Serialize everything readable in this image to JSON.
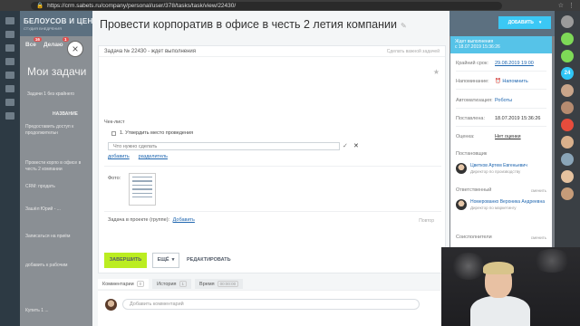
{
  "browser": {
    "url": "https://crm.sabets.ru/company/personal/user/378/tasks/task/view/22430/"
  },
  "background": {
    "company": "БЕЛОУСОВ И ЦЕНТР",
    "company_sub": "СТУДИЯ ВНЕДРЕНИЯ",
    "tabs": [
      {
        "label": "Все",
        "count": "16"
      },
      {
        "label": "Делаю",
        "count": "1"
      }
    ],
    "page_title": "Мои задачи",
    "meta": "Задачи  1  без крайнего",
    "column": "НАЗВАНИЕ",
    "rows": [
      "Предоставить доступ к продолжительн",
      "Провести корпо в офисе в честь 2 компании",
      "CRM: продать",
      "Зашёл Юрий - ...",
      "Записаться на приём",
      "добавить к рабочим",
      "Купить 1 ..."
    ]
  },
  "panel": {
    "title": "Провести корпоратив в офисе в честь 2 летия компании",
    "task_id": "Задача № 22430 - ждет выполнения",
    "important": "Сделать важной задачей",
    "add_button": "ДОБАВИТЬ"
  },
  "checklist": {
    "title": "Чек-лист",
    "item": "1. Утвердить место проведения",
    "input_placeholder": "Что нужно сделать",
    "add_link": "добавить",
    "separator_link": "разделитель"
  },
  "photo": {
    "label": "Фото:"
  },
  "project": {
    "label": "Задача в проекте (группе):",
    "link": "Добавить",
    "repeat": "Повтор"
  },
  "actions": {
    "done": "ЗАВЕРШИТЬ",
    "more": "ЕЩЁ",
    "edit": "РЕДАКТИРОВАТЬ"
  },
  "tabs": [
    {
      "label": "Комментарии",
      "count": "0"
    },
    {
      "label": "История",
      "count": "1"
    },
    {
      "label": "Время",
      "count": "00:00:00"
    }
  ],
  "comment": {
    "placeholder": "Добавить комментарий"
  },
  "sidebar": {
    "status": "Ждет выполнения",
    "status_date": "с 18.07.2019 15:36:26",
    "deadline_label": "Крайний срок:",
    "deadline_value": "29.08.2019 19:00",
    "reminder_label": "Напоминание:",
    "reminder_value": "Напомнить",
    "automation_label": "Автоматизация:",
    "automation_value": "Роботы",
    "created_label": "Поставлена:",
    "created_value": "18.07.2019 15:36:26",
    "rating_label": "Оценка:",
    "rating_value": "Нет оценки",
    "creator_label": "Постановщик",
    "creator_name": "Цветков Артем Евгеньевич",
    "creator_job": "Директор по производству",
    "responsible_label": "Ответственный",
    "responsible_change": "сменить",
    "responsible_name": "Номерованко Вероника Андреевна",
    "responsible_job": "Директор по маркетингу",
    "coexec_label": "Соисполнители",
    "coexec_change": "сменить"
  },
  "right_rail": {
    "badge": "24"
  }
}
